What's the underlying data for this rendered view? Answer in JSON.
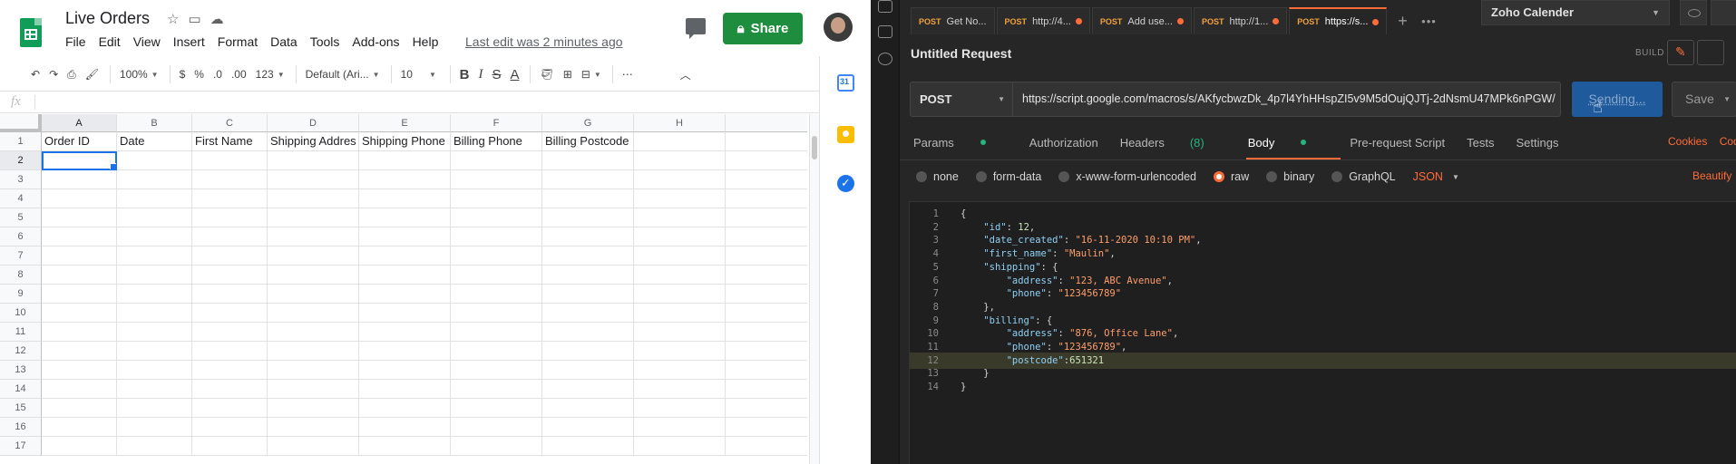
{
  "sheets": {
    "title": "Live Orders",
    "menu": [
      "File",
      "Edit",
      "View",
      "Insert",
      "Format",
      "Data",
      "Tools",
      "Add-ons",
      "Help"
    ],
    "last_edit": "Last edit was 2 minutes ago",
    "share_label": "Share",
    "toolbar": {
      "zoom": "100%",
      "currency": "$",
      "percent": "%",
      "dec_less": ".0",
      "dec_more": ".00",
      "number_format": "123",
      "font": "Default (Ari...",
      "font_size": "10",
      "bold": "B",
      "italic": "I",
      "strike": "S",
      "text_color": "A"
    },
    "fx": "fx",
    "columns": [
      "A",
      "B",
      "C",
      "D",
      "E",
      "F",
      "G",
      "H"
    ],
    "rows": [
      "1",
      "2",
      "3",
      "4",
      "5",
      "6",
      "7",
      "8",
      "9",
      "10",
      "11",
      "12",
      "13",
      "14",
      "15",
      "16",
      "17"
    ],
    "header_row": [
      "Order ID",
      "Date",
      "First Name",
      "Shipping Addres",
      "Shipping Phone",
      "Billing Phone",
      "Billing Postcode",
      ""
    ],
    "active_cell": "A2"
  },
  "postman": {
    "tabs": [
      {
        "method": "POST",
        "label": "Get No...",
        "dot": false
      },
      {
        "method": "POST",
        "label": "http://4...",
        "dot": true
      },
      {
        "method": "POST",
        "label": "Add use...",
        "dot": true
      },
      {
        "method": "POST",
        "label": "http://1...",
        "dot": true
      },
      {
        "method": "POST",
        "label": "https://s...",
        "dot": true
      }
    ],
    "environment": "Zoho Calender",
    "request_title": "Untitled Request",
    "build_label": "BUILD",
    "method": "POST",
    "url": "https://script.google.com/macros/s/AKfycbwzDk_4p7l4YhHHspZI5v9M5dOujQJTj-2dNsmU47MPk6nPGW/",
    "send_label": "Sending...",
    "save_label": "Save",
    "subtabs": {
      "params": "Params",
      "authorization": "Authorization",
      "headers": "Headers",
      "headers_count": "(8)",
      "body": "Body",
      "prerequest": "Pre-request Script",
      "tests": "Tests",
      "settings": "Settings"
    },
    "cookies_label": "Cookies",
    "code_label": "Code",
    "body_types": [
      "none",
      "form-data",
      "x-www-form-urlencoded",
      "raw",
      "binary",
      "GraphQL"
    ],
    "selected_body_type": "raw",
    "format": "JSON",
    "beautify_label": "Beautify",
    "code_lines": [
      {
        "ln": "1",
        "text": "{"
      },
      {
        "ln": "2",
        "text": "    \"id\": 12,"
      },
      {
        "ln": "3",
        "text": "    \"date_created\": \"16-11-2020 10:10 PM\","
      },
      {
        "ln": "4",
        "text": "    \"first_name\": \"Maulin\","
      },
      {
        "ln": "5",
        "text": "    \"shipping\": {"
      },
      {
        "ln": "6",
        "text": "        \"address\": \"123, ABC Avenue\","
      },
      {
        "ln": "7",
        "text": "        \"phone\": \"123456789\""
      },
      {
        "ln": "8",
        "text": "    },"
      },
      {
        "ln": "9",
        "text": "    \"billing\": {"
      },
      {
        "ln": "10",
        "text": "        \"address\": \"876, Office Lane\","
      },
      {
        "ln": "11",
        "text": "        \"phone\": \"123456789\","
      },
      {
        "ln": "12",
        "text": "        \"postcode\":651321"
      },
      {
        "ln": "13",
        "text": "    }"
      },
      {
        "ln": "14",
        "text": "}"
      }
    ],
    "highlighted_line": "12"
  }
}
